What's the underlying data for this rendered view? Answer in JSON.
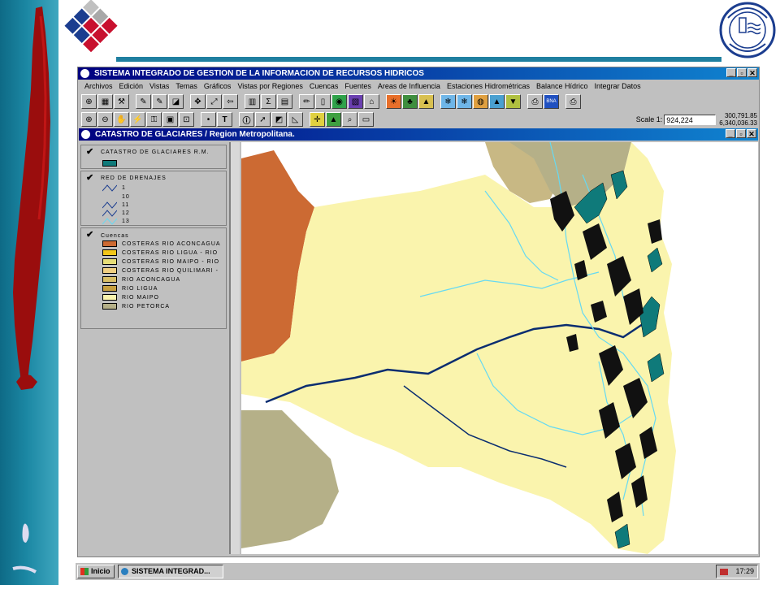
{
  "app": {
    "title": "SISTEMA INTEGRADO DE GESTION DE LA INFORMACION DE RECURSOS HIDRICOS",
    "window_controls": [
      "_",
      "▫",
      "✕"
    ]
  },
  "menu": [
    "Archivos",
    "Edición",
    "Vistas",
    "Temas",
    "Gráficos",
    "Vistas por Regiones",
    "Cuencas",
    "Fuentes",
    "Areas de Influencia",
    "Estaciones Hidrométricas",
    "Balance Hídrico",
    "Integrar Datos"
  ],
  "toolbar": {
    "scale_label": "Scale 1:",
    "scale_value": "924,224",
    "coord_x": "300,791.85",
    "coord_y": "6,340,036.33"
  },
  "view": {
    "title": "CATASTRO DE GLACIARES / Region Metropolitana."
  },
  "toc": {
    "glaciares": {
      "title": "CATASTRO DE GLACIARES R.M."
    },
    "drenajes": {
      "title": "RED DE DRENAJES",
      "items": [
        "1",
        "10",
        "11",
        "12",
        "13"
      ]
    },
    "cuencas": {
      "title": "Cuencas",
      "items": [
        "COSTERAS RIO ACONCAGUA",
        "COSTERAS RIO LIGUA - RIO",
        "COSTERAS RIO MAIPO - RIO",
        "COSTERAS RIO QUILIMARI -",
        "RIO ACONCAGUA",
        "RIO LIGUA",
        "RIO MAIPO",
        "RIO PETORCA"
      ]
    }
  },
  "colors": {
    "glacier": "#0f7a7a",
    "aconcagua_costeras": "#cc6a33",
    "ligua_costeras": "#f2c61a",
    "maipo_costeras": "#e6dd78",
    "quilimari_costeras": "#f0cf82",
    "aconcagua": "#d9bf66",
    "ligua": "#c7a03f",
    "maipo": "#faf4ad",
    "petorca": "#b5b088",
    "drainage_light": "#66d9f2",
    "drainage_dark": "#0a2d70"
  },
  "taskbar": {
    "start": "Inicio",
    "task": "SISTEMA INTEGRAD...",
    "clock": "17:29"
  }
}
